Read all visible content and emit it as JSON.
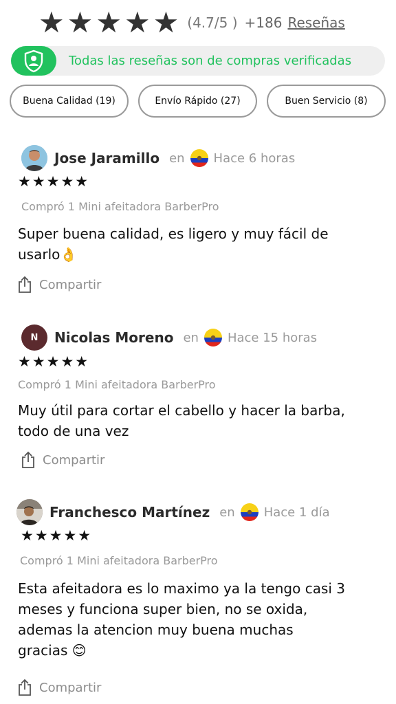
{
  "summary": {
    "rating_text": "(4.7/5 )",
    "count_text": "+186",
    "reviews_link": "Reseñas",
    "star_color": "#333333"
  },
  "verified": {
    "text": "Todas las reseñas son de compras verificadas",
    "icon": "shield-user-icon",
    "color": "#21c25e"
  },
  "filters": [
    {
      "label": "Buena Calidad (19)"
    },
    {
      "label": "Envío Rápido (27)"
    },
    {
      "label": "Buen Servicio (8)"
    }
  ],
  "reviews": [
    {
      "author": "Jose Jaramillo",
      "en": "en",
      "flag": "ecuador-flag-icon",
      "time": "Hace 6 horas",
      "stars": "★★★★★",
      "purchase": "Compró 1 Mini afeitadora BarberPro",
      "text_lines": [
        "Super buena calidad, es ligero y muy fácil de",
        "usarlo👌"
      ],
      "share": "Compartir"
    },
    {
      "author": "Nicolas Moreno",
      "avatar_initial": "N",
      "en": "en",
      "flag": "ecuador-flag-icon",
      "time": "Hace 15 horas",
      "stars": "★★★★★",
      "purchase": "Compró 1 Mini afeitadora BarberPro",
      "text_lines": [
        "Muy útil para cortar el cabello y hacer la barba,",
        "todo de una vez"
      ],
      "share": "Compartir"
    },
    {
      "author": "Franchesco Martínez",
      "en": "en",
      "flag": "ecuador-flag-icon",
      "time": "Hace 1 día",
      "stars": "★★★★★",
      "purchase": "Compró 1 Mini afeitadora BarberPro",
      "text_lines": [
        "Esta afeitadora es lo maximo ya la tengo casi 3",
        "meses y funciona super bien, no se oxida,",
        "ademas la atencion muy buena muchas",
        "gracias 😊"
      ],
      "share": "Compartir"
    }
  ]
}
